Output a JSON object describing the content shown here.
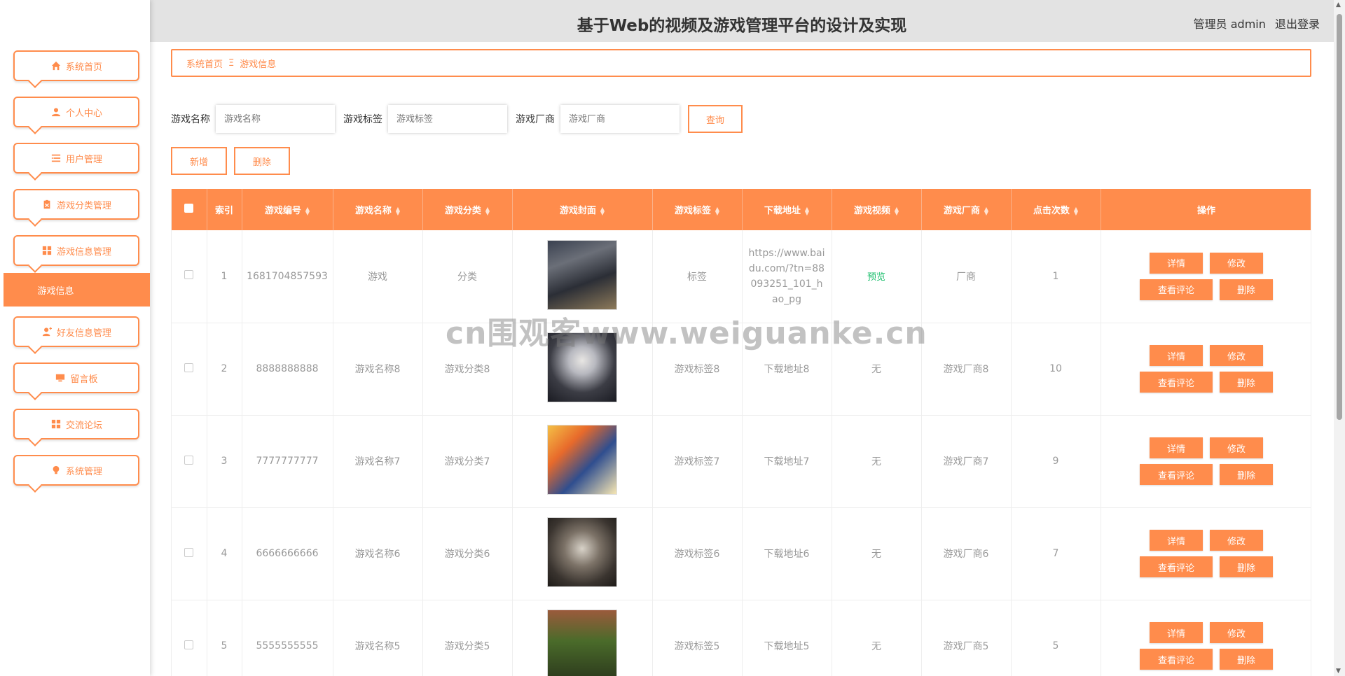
{
  "header": {
    "title": "基于Web的视频及游戏管理平台的设计及实现",
    "user_label": "管理员 admin",
    "logout_label": "退出登录"
  },
  "sidebar": {
    "items": [
      {
        "label": "系统首页",
        "icon": "home-icon"
      },
      {
        "label": "个人中心",
        "icon": "user-icon"
      },
      {
        "label": "用户管理",
        "icon": "list-icon"
      },
      {
        "label": "游戏分类管理",
        "icon": "clipboard-icon"
      },
      {
        "label": "游戏信息管理",
        "icon": "grid-icon"
      },
      {
        "label": "好友信息管理",
        "icon": "user-add-icon"
      },
      {
        "label": "留言板",
        "icon": "monitor-icon"
      },
      {
        "label": "交流论坛",
        "icon": "grid-icon"
      },
      {
        "label": "系统管理",
        "icon": "bulb-icon"
      }
    ],
    "active_sub": "游戏信息"
  },
  "breadcrumb": {
    "home": "系统首页",
    "sep": "Ξ",
    "current": "游戏信息"
  },
  "search": {
    "name_label": "游戏名称",
    "name_placeholder": "游戏名称",
    "tag_label": "游戏标签",
    "tag_placeholder": "游戏标签",
    "vendor_label": "游戏厂商",
    "vendor_placeholder": "游戏厂商",
    "query_label": "查询"
  },
  "actions": {
    "add_label": "新增",
    "delete_label": "删除"
  },
  "table": {
    "headers": [
      "索引",
      "游戏编号",
      "游戏名称",
      "游戏分类",
      "游戏封面",
      "游戏标签",
      "下载地址",
      "游戏视频",
      "游戏厂商",
      "点击次数",
      "操作"
    ],
    "rows": [
      {
        "index": "1",
        "code": "1681704857593",
        "name": "游戏",
        "category": "分类",
        "tag": "标签",
        "url": "https://www.baidu.com/?tn=88093251_101_hao_pg",
        "video": "预览",
        "vendor": "厂商",
        "clicks": "1"
      },
      {
        "index": "2",
        "code": "8888888888",
        "name": "游戏名称8",
        "category": "游戏分类8",
        "tag": "游戏标签8",
        "url": "下载地址8",
        "video": "无",
        "vendor": "游戏厂商8",
        "clicks": "10"
      },
      {
        "index": "3",
        "code": "7777777777",
        "name": "游戏名称7",
        "category": "游戏分类7",
        "tag": "游戏标签7",
        "url": "下载地址7",
        "video": "无",
        "vendor": "游戏厂商7",
        "clicks": "9"
      },
      {
        "index": "4",
        "code": "6666666666",
        "name": "游戏名称6",
        "category": "游戏分类6",
        "tag": "游戏标签6",
        "url": "下载地址6",
        "video": "无",
        "vendor": "游戏厂商6",
        "clicks": "7"
      },
      {
        "index": "5",
        "code": "5555555555",
        "name": "游戏名称5",
        "category": "游戏分类5",
        "tag": "游戏标签5",
        "url": "下载地址5",
        "video": "无",
        "vendor": "游戏厂商5",
        "clicks": "5"
      }
    ],
    "op_detail": "详情",
    "op_edit": "修改",
    "op_comments": "查看评论",
    "op_delete": "删除"
  },
  "watermark": "cn围观客www.weiguanke.cn",
  "colors": {
    "accent": "#ff8c4c",
    "video_link": "#19be6b"
  }
}
